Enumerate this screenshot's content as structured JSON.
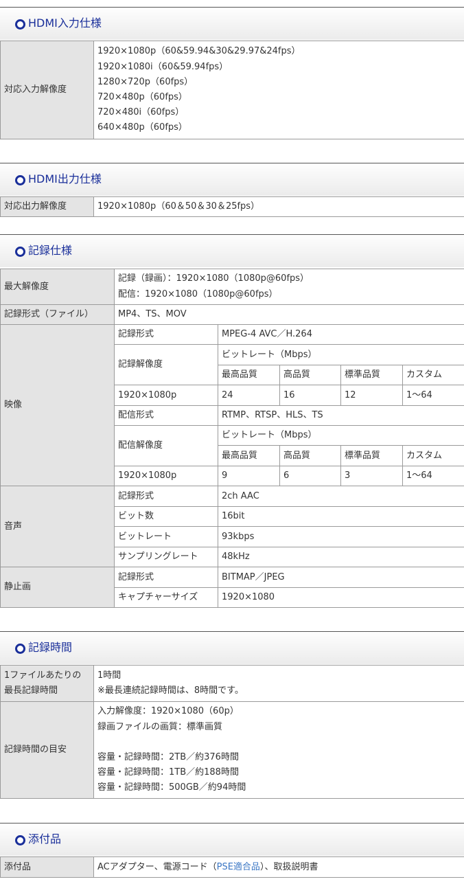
{
  "hdmi_in": {
    "title": "HDMI入力仕様",
    "label": "対応入力解像度",
    "values": [
      "1920×1080p（60&59.94&30&29.97&24fps）",
      "1920×1080i（60&59.94fps）",
      "1280×720p（60fps）",
      "720×480p（60fps）",
      "720×480i（60fps）",
      "640×480p（60fps）"
    ]
  },
  "hdmi_out": {
    "title": "HDMI出力仕様",
    "label": "対応出力解像度",
    "value": "1920×1080p（60＆50＆30＆25fps）"
  },
  "record": {
    "title": "記録仕様",
    "max_res_label": "最大解像度",
    "max_res_values": [
      "記録（録画）：1920×1080（1080p@60fps）",
      "配信：1920×1080（1080p@60fps）"
    ],
    "format_label": "記録形式（ファイル）",
    "format_value": "MP4、TS、MOV",
    "video": {
      "label": "映像",
      "rec_format_label": "記録形式",
      "rec_format_value": "MPEG-4 AVC／H.264",
      "rec_res_label": "記録解像度",
      "bitrate_header": "ビットレート（Mbps）",
      "quality_headers": [
        "最高品質",
        "高品質",
        "標準品質",
        "カスタム"
      ],
      "rec_row_res": "1920×1080p",
      "rec_row_values": [
        "24",
        "16",
        "12",
        "1〜64"
      ],
      "stream_format_label": "配信形式",
      "stream_format_value": "RTMP、RTSP、HLS、TS",
      "stream_res_label": "配信解像度",
      "stream_row_res": "1920×1080p",
      "stream_row_values": [
        "9",
        "6",
        "3",
        "1〜64"
      ]
    },
    "audio": {
      "label": "音声",
      "rows": [
        {
          "label": "記録形式",
          "value": "2ch AAC"
        },
        {
          "label": "ビット数",
          "value": "16bit"
        },
        {
          "label": "ビットレート",
          "value": "93kbps"
        },
        {
          "label": "サンプリングレート",
          "value": "48kHz"
        }
      ]
    },
    "still": {
      "label": "静止画",
      "rows": [
        {
          "label": "記録形式",
          "value": "BITMAP／JPEG"
        },
        {
          "label": "キャプチャーサイズ",
          "value": "1920×1080"
        }
      ]
    }
  },
  "rec_time": {
    "title": "記録時間",
    "row1_label": [
      "1ファイルあたりの",
      "最長記録時間"
    ],
    "row1_values": [
      "1時間",
      "※最長連続記録時間は、8時間です。"
    ],
    "row2_label": "記録時間の目安",
    "row2_values": [
      "入力解像度：1920×1080（60p）",
      "録画ファイルの画質：標準画質",
      "",
      "容量・記録時間：2TB／約376時間",
      "容量・記録時間：1TB／約188時間",
      "容量・記録時間：500GB／約94時間"
    ]
  },
  "accessories": {
    "title": "添付品",
    "label": "添付品",
    "value_before": "ACアダプター、電源コード（",
    "value_link": "PSE適合品",
    "value_after": "）、取扱説明書"
  }
}
